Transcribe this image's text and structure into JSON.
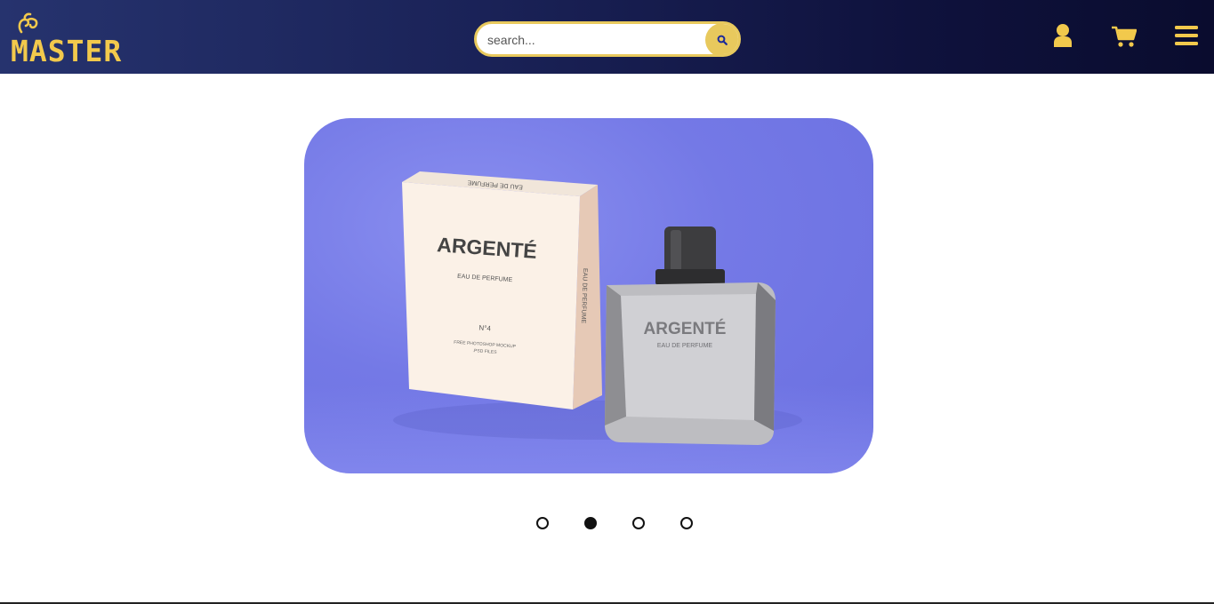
{
  "header": {
    "logo_text": "MASTER",
    "search": {
      "placeholder": "search..."
    }
  },
  "hero": {
    "box": {
      "brand": "ARGENTÉ",
      "subtitle": "EAU DE PERFUME",
      "number": "N°4",
      "note_line1": "FREE PHOTOSHOP MOCKUP",
      "note_line2": ".PSD FILES",
      "side_text": "EAU DE PERFUME",
      "top_text": "EAU DE PERFUME"
    },
    "bottle": {
      "brand": "ARGENTÉ",
      "subtitle": "EAU DE PERFUME"
    }
  },
  "carousel": {
    "slide_count": 4,
    "active_index": 1
  },
  "colors": {
    "accent": "#e8c95d",
    "nav_start": "#26336e",
    "nav_end": "#0a0c2e",
    "hero_bg": "#7479e6"
  },
  "icons": [
    "user-icon",
    "cart-icon",
    "menu-icon",
    "search-icon"
  ]
}
